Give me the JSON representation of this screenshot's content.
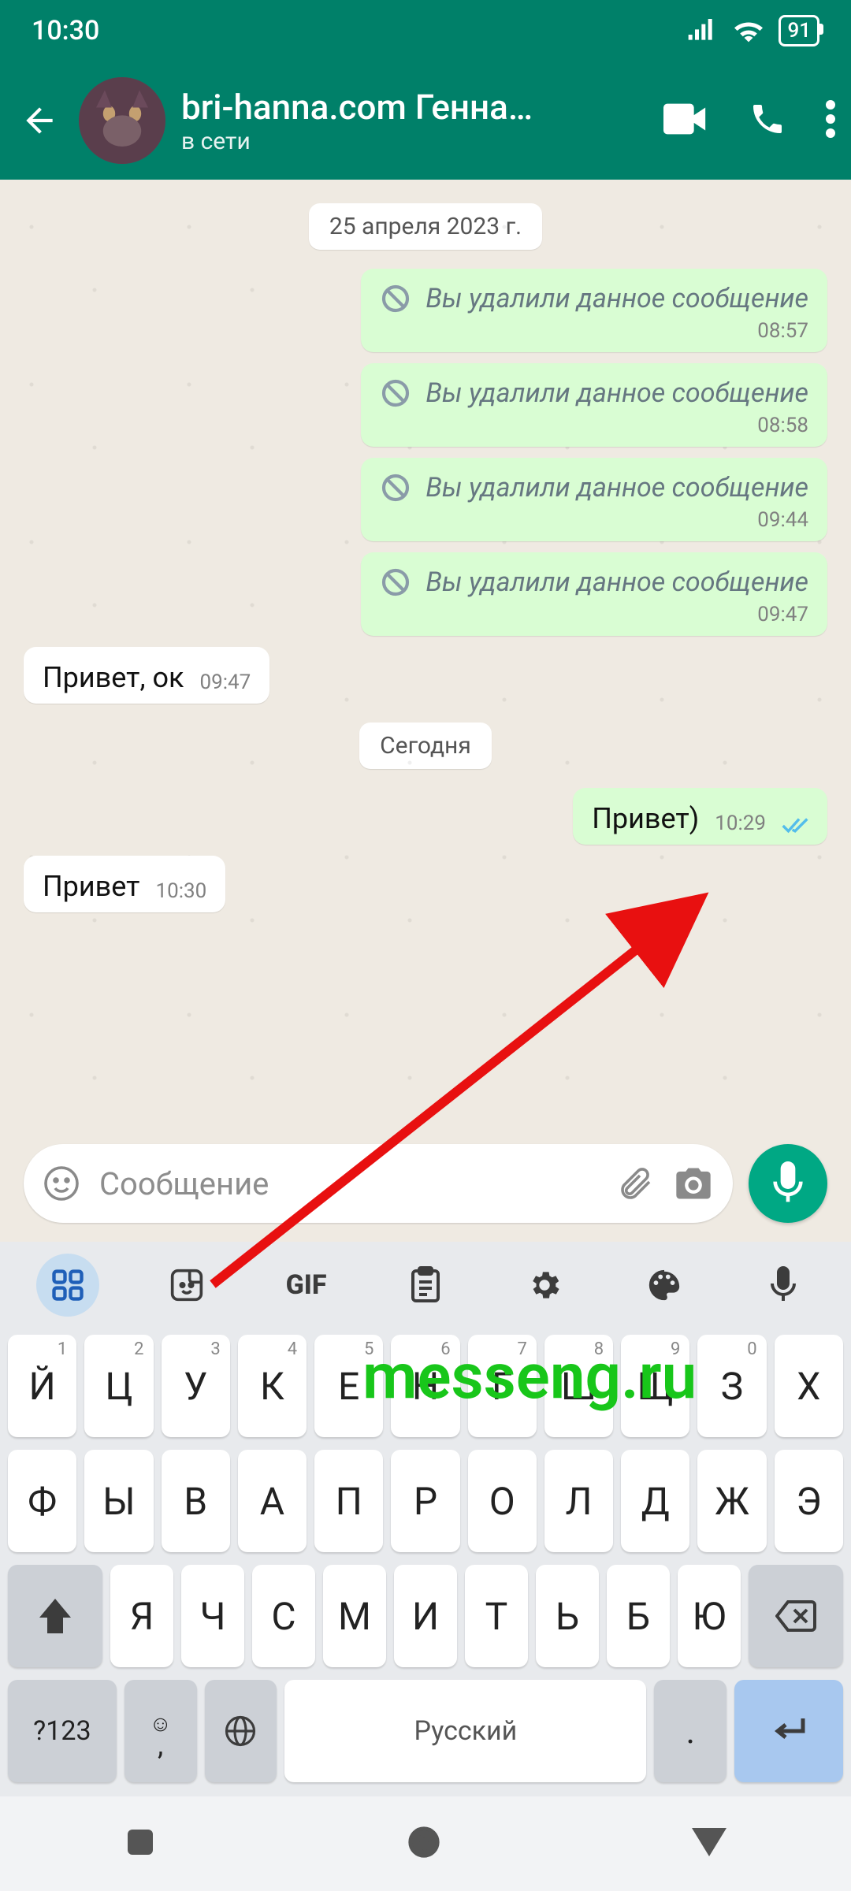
{
  "status": {
    "time": "10:30",
    "battery": "91"
  },
  "header": {
    "name": "bri-hanna.com Генна…",
    "presence": "в сети"
  },
  "chat": {
    "date1": "25 апреля 2023 г.",
    "deleted_text": "Вы удалили данное сообщение",
    "msgs": [
      {
        "kind": "deleted",
        "time": "08:57"
      },
      {
        "kind": "deleted",
        "time": "08:58"
      },
      {
        "kind": "deleted",
        "time": "09:44"
      },
      {
        "kind": "deleted",
        "time": "09:47"
      }
    ],
    "in1": {
      "text": "Привет, ок",
      "time": "09:47"
    },
    "date2": "Сегодня",
    "out1": {
      "text": "Привет)",
      "time": "10:29"
    },
    "in2": {
      "text": "Привет",
      "time": "10:30"
    }
  },
  "composer": {
    "placeholder": "Сообщение"
  },
  "keyboard": {
    "gif": "GIF",
    "row1": [
      {
        "k": "Й",
        "s": "1"
      },
      {
        "k": "Ц",
        "s": "2"
      },
      {
        "k": "У",
        "s": "3"
      },
      {
        "k": "К",
        "s": "4"
      },
      {
        "k": "Е",
        "s": "5"
      },
      {
        "k": "Н",
        "s": "6"
      },
      {
        "k": "Г",
        "s": "7"
      },
      {
        "k": "Ш",
        "s": "8"
      },
      {
        "k": "Щ",
        "s": "9"
      },
      {
        "k": "З",
        "s": "0"
      },
      {
        "k": "Х",
        "s": ""
      }
    ],
    "row2": [
      "Ф",
      "Ы",
      "В",
      "А",
      "П",
      "Р",
      "О",
      "Л",
      "Д",
      "Ж",
      "Э"
    ],
    "row3": [
      "Я",
      "Ч",
      "С",
      "М",
      "И",
      "Т",
      "Ь",
      "Б",
      "Ю"
    ],
    "numkey": "?123",
    "space": "Русский",
    "period": "."
  },
  "watermark": "messeng.ru"
}
